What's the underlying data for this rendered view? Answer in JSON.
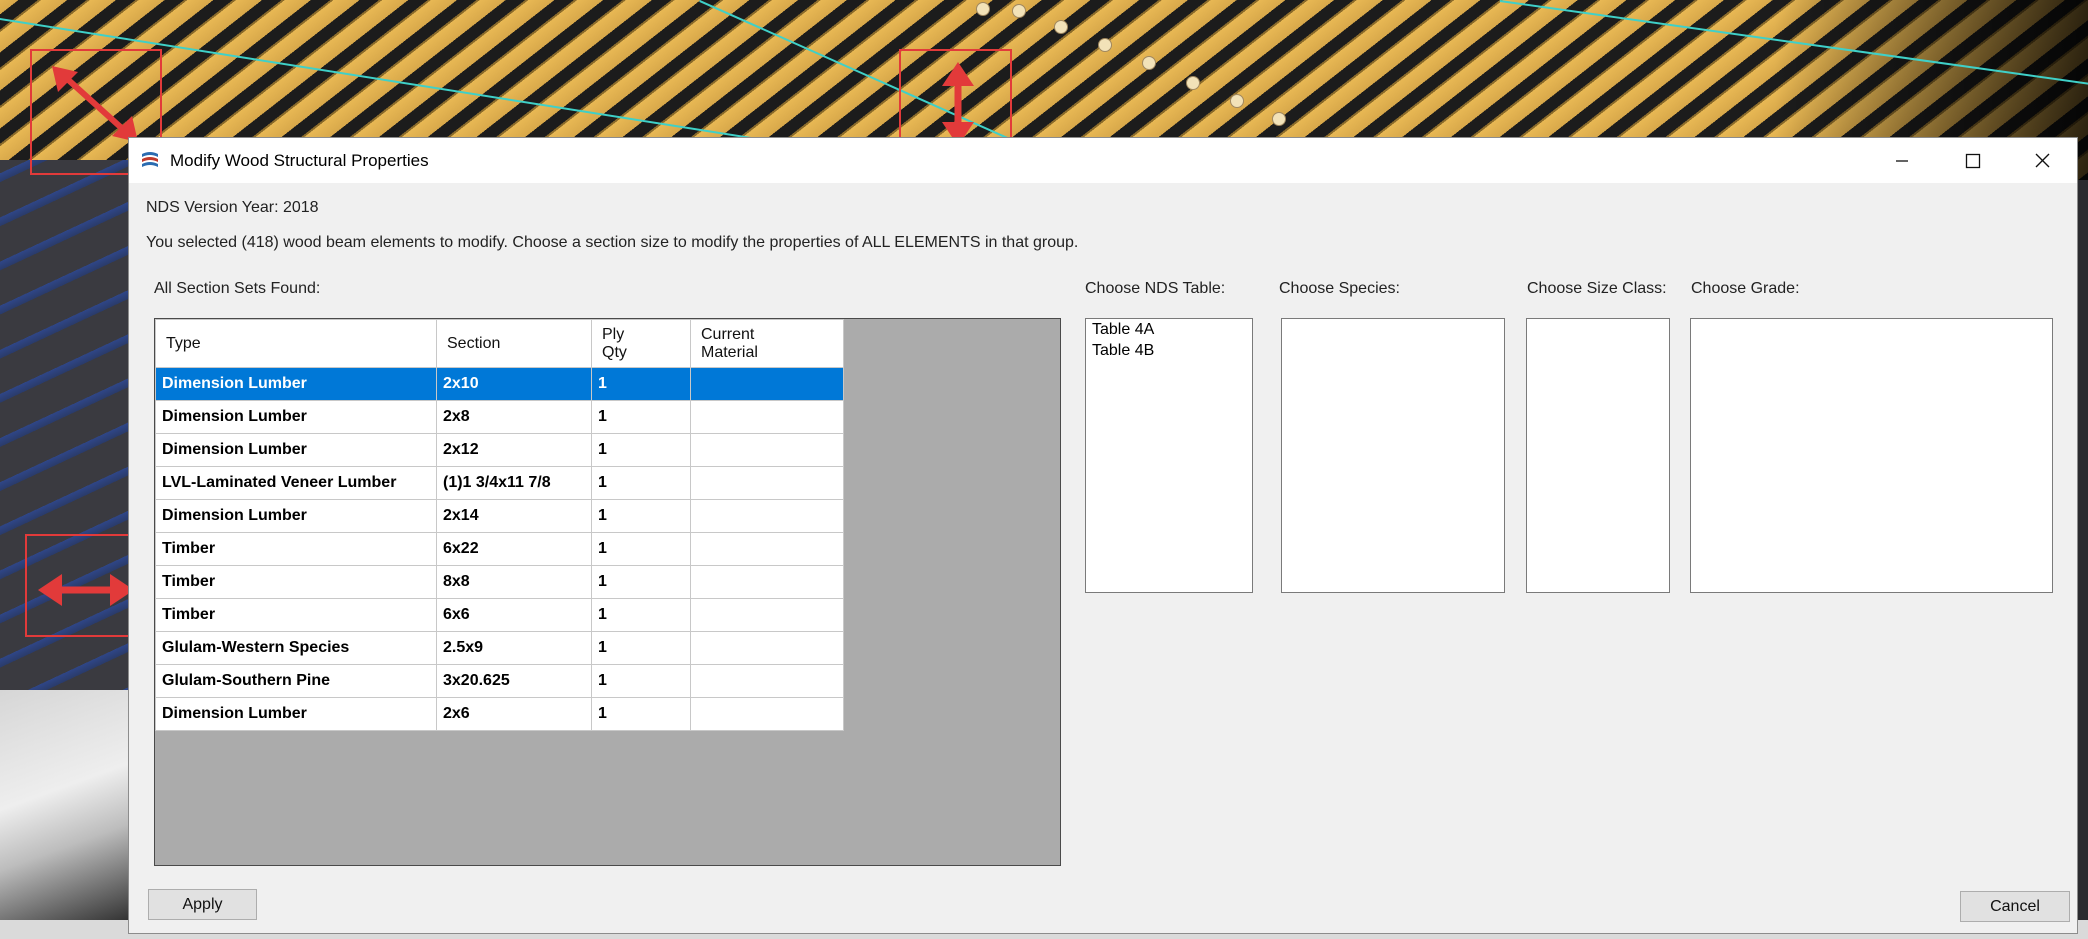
{
  "window": {
    "title": "Modify Wood Structural Properties",
    "icons": {
      "app": "wood-structural-app-icon",
      "minimize": "minimize-icon",
      "maximize": "maximize-icon",
      "close": "close-icon"
    }
  },
  "info": {
    "nds_version": "NDS Version Year: 2018",
    "instructions": "You selected (418) wood beam elements to modify. Choose a section size to modify the properties of ALL ELEMENTS in that group."
  },
  "section_sets": {
    "label": "All Section Sets Found:",
    "columns": [
      "Type",
      "Section",
      "Ply Qty",
      "Current Material"
    ],
    "rows": [
      {
        "type": "Dimension Lumber",
        "section": "2x10",
        "ply": "1",
        "material": "",
        "selected": true
      },
      {
        "type": "Dimension Lumber",
        "section": "2x8",
        "ply": "1",
        "material": ""
      },
      {
        "type": "Dimension Lumber",
        "section": "2x12",
        "ply": "1",
        "material": ""
      },
      {
        "type": "LVL-Laminated Veneer Lumber",
        "section": "(1)1 3/4x11 7/8",
        "ply": "1",
        "material": ""
      },
      {
        "type": "Dimension Lumber",
        "section": "2x14",
        "ply": "1",
        "material": ""
      },
      {
        "type": "Timber",
        "section": "6x22",
        "ply": "1",
        "material": ""
      },
      {
        "type": "Timber",
        "section": "8x8",
        "ply": "1",
        "material": ""
      },
      {
        "type": "Timber",
        "section": "6x6",
        "ply": "1",
        "material": ""
      },
      {
        "type": "Glulam-Western Species",
        "section": "2.5x9",
        "ply": "1",
        "material": ""
      },
      {
        "type": "Glulam-Southern Pine",
        "section": "3x20.625",
        "ply": "1",
        "material": ""
      },
      {
        "type": "Dimension Lumber",
        "section": "2x6",
        "ply": "1",
        "material": ""
      }
    ]
  },
  "nds_table": {
    "label": "Choose NDS Table:",
    "items": [
      "Table 4A",
      "Table 4B"
    ]
  },
  "species": {
    "label": "Choose Species:",
    "items": []
  },
  "size_class": {
    "label": "Choose Size Class:",
    "items": []
  },
  "grade": {
    "label": "Choose Grade:",
    "items": []
  },
  "buttons": {
    "apply": "Apply",
    "cancel": "Cancel"
  },
  "colors": {
    "selection": "#0078d7",
    "annotation": "#e23a3a",
    "beam": "#e8b854"
  }
}
